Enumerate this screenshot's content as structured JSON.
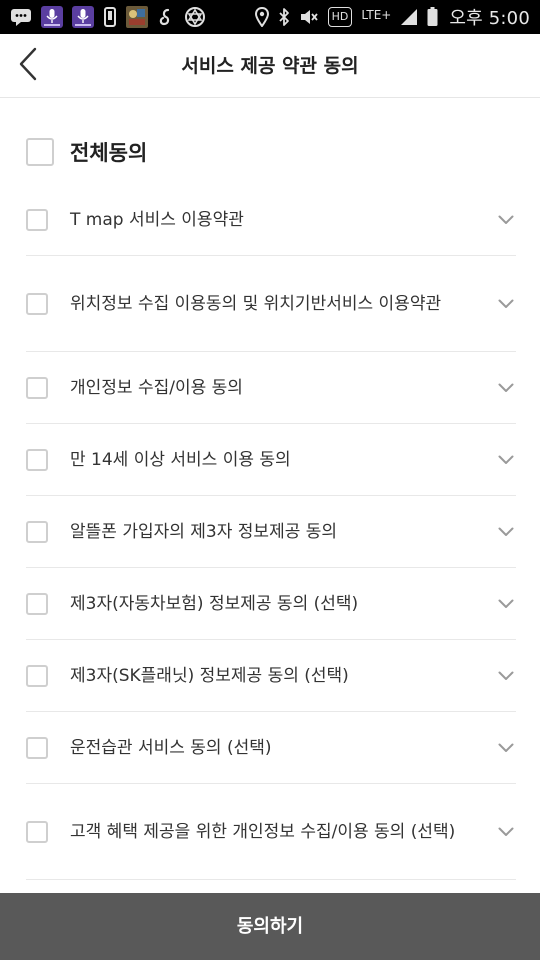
{
  "status_bar": {
    "time": "오후 5:00",
    "network_badge": "HD",
    "network_type": "LTE+",
    "icons": [
      "chat-icon",
      "mic-app-icon",
      "mic-app-icon",
      "phone-icon",
      "game-app-icon",
      "link-icon",
      "shield-app-icon",
      "location-icon",
      "bluetooth-icon",
      "mute-icon",
      "signal-icon",
      "battery-icon"
    ]
  },
  "header": {
    "title": "서비스 제공 약관 동의",
    "back_icon": "chevron-left-icon"
  },
  "agree_all": {
    "label": "전체동의",
    "checked": false
  },
  "terms": [
    {
      "label": "T map 서비스 이용약관",
      "checked": false
    },
    {
      "label": "위치정보 수집 이용동의 및 위치기반서비스 이용약관",
      "checked": false
    },
    {
      "label": "개인정보 수집/이용 동의",
      "checked": false
    },
    {
      "label": "만 14세 이상 서비스 이용 동의",
      "checked": false
    },
    {
      "label": "알뜰폰 가입자의 제3자 정보제공 동의",
      "checked": false
    },
    {
      "label": "제3자(자동차보험) 정보제공 동의 (선택)",
      "checked": false
    },
    {
      "label": "제3자(SK플래닛) 정보제공 동의 (선택)",
      "checked": false
    },
    {
      "label": "운전습관 서비스 동의 (선택)",
      "checked": false
    },
    {
      "label": "고객 혜택 제공을 위한 개인정보 수집/이용 동의 (선택)",
      "checked": false
    }
  ],
  "submit": {
    "label": "동의하기"
  },
  "colors": {
    "status_bar_bg": "#000000",
    "submit_bg": "#595959",
    "checkbox_border": "#cfcfcf",
    "chevron": "#9a9a9a"
  }
}
